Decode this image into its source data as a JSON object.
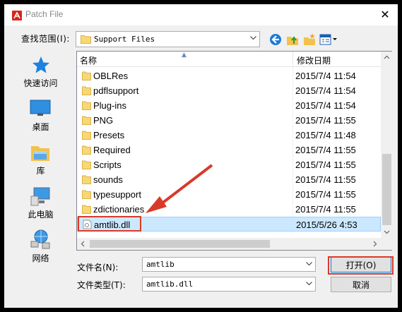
{
  "window": {
    "title": "Patch File",
    "close_glyph": "✕"
  },
  "lookin": {
    "label": "查找范围(I):",
    "value": "Support Files"
  },
  "toolbar": {
    "icons": [
      "back-icon",
      "up-folder-icon",
      "new-folder-icon",
      "view-menu-icon"
    ]
  },
  "places": [
    {
      "label": "快速访问",
      "icon": "star-icon"
    },
    {
      "label": "桌面",
      "icon": "desktop-icon"
    },
    {
      "label": "库",
      "icon": "library-icon"
    },
    {
      "label": "此电脑",
      "icon": "computer-icon"
    },
    {
      "label": "网络",
      "icon": "network-icon"
    }
  ],
  "columns": {
    "name": "名称",
    "date": "修改日期"
  },
  "files": [
    {
      "name": "OBLRes",
      "date": "2015/7/4 11:54",
      "type": "folder"
    },
    {
      "name": "pdflsupport",
      "date": "2015/7/4 11:54",
      "type": "folder"
    },
    {
      "name": "Plug-ins",
      "date": "2015/7/4 11:54",
      "type": "folder"
    },
    {
      "name": "PNG",
      "date": "2015/7/4 11:55",
      "type": "folder"
    },
    {
      "name": "Presets",
      "date": "2015/7/4 11:48",
      "type": "folder"
    },
    {
      "name": "Required",
      "date": "2015/7/4 11:55",
      "type": "folder"
    },
    {
      "name": "Scripts",
      "date": "2015/7/4 11:55",
      "type": "folder"
    },
    {
      "name": "sounds",
      "date": "2015/7/4 11:55",
      "type": "folder"
    },
    {
      "name": "typesupport",
      "date": "2015/7/4 11:55",
      "type": "folder"
    },
    {
      "name": "zdictionaries",
      "date": "2015/7/4 11:55",
      "type": "folder"
    },
    {
      "name": "amtlib.dll",
      "date": "2015/5/26 4:53",
      "type": "dll",
      "selected": true
    }
  ],
  "filename": {
    "label": "文件名(N):",
    "value": "amtlib"
  },
  "filetype": {
    "label": "文件类型(T):",
    "value": "amtlib.dll"
  },
  "buttons": {
    "open": "打开(O)",
    "cancel": "取消"
  },
  "colors": {
    "annotation": "#d83a2a",
    "selection": "#cce8ff",
    "folder": "#f8d775"
  }
}
